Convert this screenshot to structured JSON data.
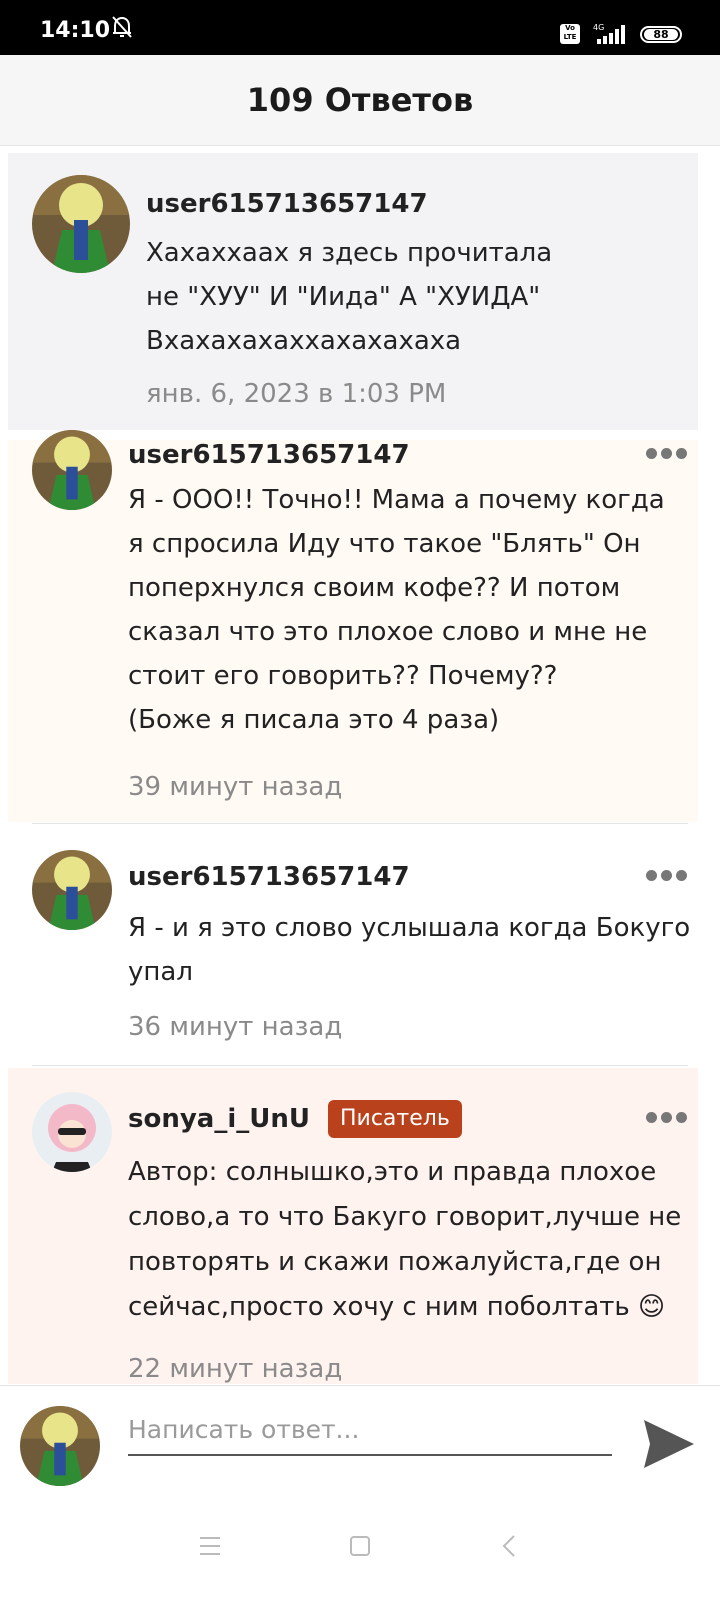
{
  "status_bar": {
    "time": "14:10",
    "battery": "88",
    "network": "4G",
    "volte": "Vo LTE"
  },
  "header": {
    "title": "109 Ответов"
  },
  "parent_comment": {
    "username": "user615713657147",
    "text_lines": [
      "Хахаххаах я здесь прочитала",
      "не \"ХУУ\" И \"Иида\" А \"ХУИДА\"",
      "Вхахахахаххахахахаха"
    ],
    "time": "янв. 6, 2023 в 1:03 PM"
  },
  "replies": [
    {
      "username": "user615713657147",
      "text_lines": [
        "Я - ООО!! Точно!! Мама а почему когда",
        "я спросила Иду что такое \"Блять\" Он",
        "поперхнулся своим кофе?? И потом",
        "сказал что это плохое слово и мне не",
        "стоит его говорить?? Почему??",
        "(Боже я писала это 4 раза)"
      ],
      "time": "39 минут назад"
    },
    {
      "username": "user615713657147",
      "text_lines": [
        "Я - и я это слово услышала когда Бокуго",
        "упал"
      ],
      "time": "36 минут назад"
    },
    {
      "username": "sonya_i_UnU",
      "badge": "Писатель",
      "text_lines": [
        "Автор: солнышко,это и правда плохое",
        "слово,а то что Бакуго говорит,лучше не",
        "повторять и скажи пожалуйста,где он",
        "сейчас,просто хочу с ним поболтать 😊"
      ],
      "time": "22 минут назад"
    }
  ],
  "reply_input": {
    "placeholder": "Написать ответ..."
  },
  "colors": {
    "highlight_bg": "#fffaf4",
    "author_bg": "#fff3f0",
    "parent_bg": "#f3f3f6",
    "badge": "#b9411c"
  },
  "icons": [
    "bell-off-icon",
    "send-icon",
    "more-icon",
    "nav-menu-icon",
    "nav-home-icon",
    "nav-back-icon"
  ]
}
